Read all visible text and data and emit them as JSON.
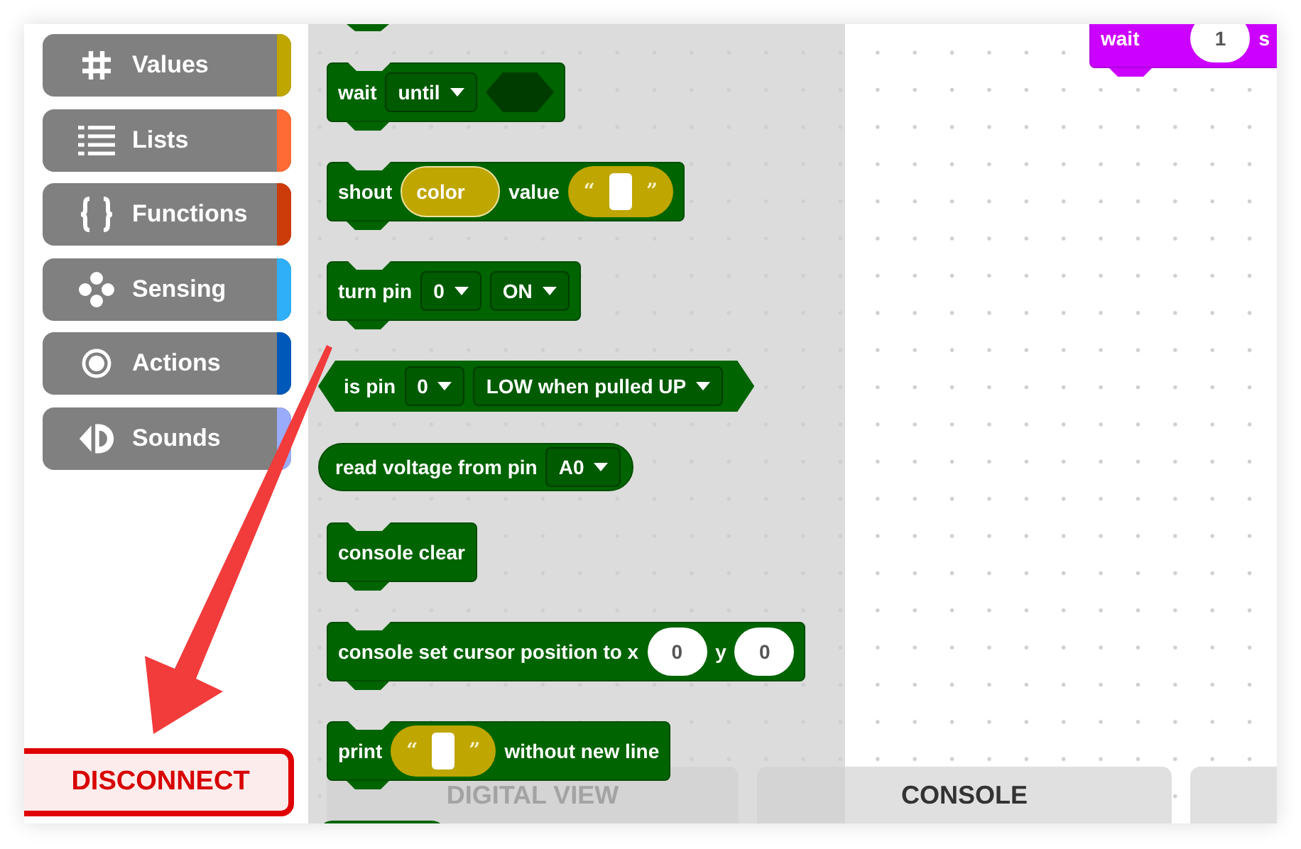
{
  "categories": [
    {
      "label": "Values",
      "color": "#bfa600"
    },
    {
      "label": "Lists",
      "color": "#ff6b35"
    },
    {
      "label": "Functions",
      "color": "#cc3b0a"
    },
    {
      "label": "Sensing",
      "color": "#2eaff8"
    },
    {
      "label": "Actions",
      "color": "#0059b8"
    },
    {
      "label": "Sounds",
      "color": "#9aabfb"
    }
  ],
  "disconnect_button": {
    "label": "DISCONNECT"
  },
  "flyout": {
    "blocks": [
      {
        "kind": "statement",
        "parts": [
          {
            "kind": "text",
            "text": "wait"
          },
          {
            "kind": "dropdown",
            "text": "until"
          },
          {
            "kind": "boolean-slot"
          }
        ]
      },
      {
        "kind": "statement",
        "parts": [
          {
            "kind": "text",
            "text": "shout"
          },
          {
            "kind": "variable",
            "text": "color"
          },
          {
            "kind": "text",
            "text": "value"
          },
          {
            "kind": "string",
            "open": "“",
            "close": "”"
          }
        ]
      },
      {
        "kind": "statement",
        "parts": [
          {
            "kind": "text",
            "text": "turn pin"
          },
          {
            "kind": "dropdown",
            "text": "0"
          },
          {
            "kind": "dropdown",
            "text": "ON"
          }
        ]
      },
      {
        "kind": "boolean",
        "parts": [
          {
            "kind": "text",
            "text": "is pin"
          },
          {
            "kind": "dropdown",
            "text": "0"
          },
          {
            "kind": "dropdown",
            "text": "LOW when pulled UP"
          }
        ]
      },
      {
        "kind": "reporter",
        "parts": [
          {
            "kind": "text",
            "text": "read voltage from pin"
          },
          {
            "kind": "dropdown",
            "text": "A0"
          }
        ]
      },
      {
        "kind": "statement",
        "parts": [
          {
            "kind": "text",
            "text": "console clear"
          }
        ]
      },
      {
        "kind": "statement",
        "parts": [
          {
            "kind": "text",
            "text": "console set cursor position to x"
          },
          {
            "kind": "number",
            "text": "0"
          },
          {
            "kind": "text",
            "text": "y"
          },
          {
            "kind": "number",
            "text": "0"
          }
        ]
      },
      {
        "kind": "statement",
        "parts": [
          {
            "kind": "text",
            "text": "print"
          },
          {
            "kind": "string",
            "open": "“",
            "close": "”"
          },
          {
            "kind": "text",
            "text": "without new line"
          }
        ]
      }
    ]
  },
  "workspace": {
    "blocks": [
      {
        "kind": "statement",
        "parts": [
          {
            "kind": "text",
            "text": "wait"
          },
          {
            "kind": "number",
            "text": "1"
          },
          {
            "kind": "text",
            "text": "s"
          }
        ]
      }
    ]
  },
  "tabs": [
    {
      "label": "DIGITAL VIEW"
    },
    {
      "label": "CONSOLE"
    }
  ]
}
